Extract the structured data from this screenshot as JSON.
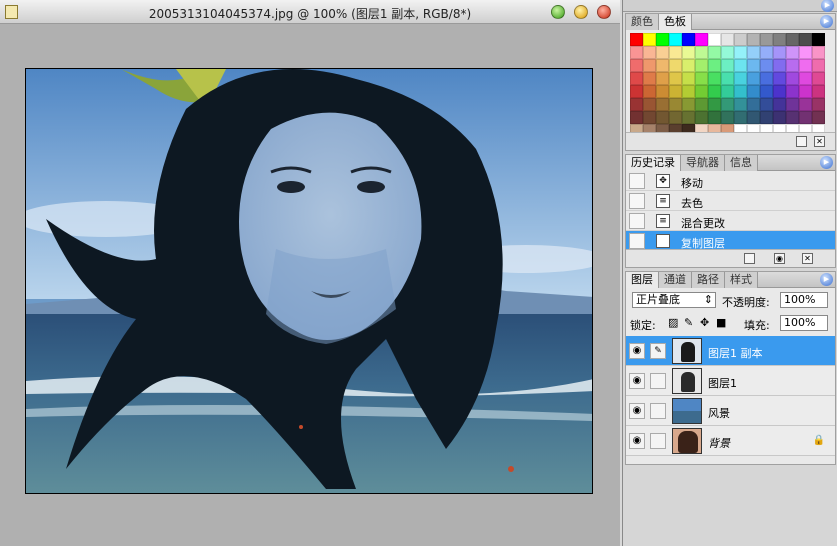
{
  "document": {
    "title": "2005313104045374.jpg @ 100% (图层1 副本, RGB/8*)"
  },
  "color_panel": {
    "tabs": [
      "颜色",
      "色板"
    ]
  },
  "history_panel": {
    "tabs": [
      "历史记录",
      "导航器",
      "信息"
    ],
    "items": [
      {
        "label": "移动",
        "icon": "move-tool-icon"
      },
      {
        "label": "去色",
        "icon": "history-state-icon"
      },
      {
        "label": "混合更改",
        "icon": "history-state-icon"
      },
      {
        "label": "复制图层",
        "icon": "history-state-icon"
      }
    ]
  },
  "layers_panel": {
    "tabs": [
      "图层",
      "通道",
      "路径",
      "样式"
    ],
    "blend_mode": "正片叠底",
    "opacity_label": "不透明度:",
    "opacity_value": "100%",
    "lock_label": "锁定:",
    "fill_label": "填充:",
    "fill_value": "100%",
    "layers": [
      {
        "name": "图层1 副本",
        "selected": true
      },
      {
        "name": "图层1",
        "selected": false
      },
      {
        "name": "风景",
        "selected": false
      },
      {
        "name": "背景",
        "selected": false
      }
    ]
  },
  "colors": {
    "selection": "#3a9aee",
    "panel_bg": "#e9e9e9"
  }
}
